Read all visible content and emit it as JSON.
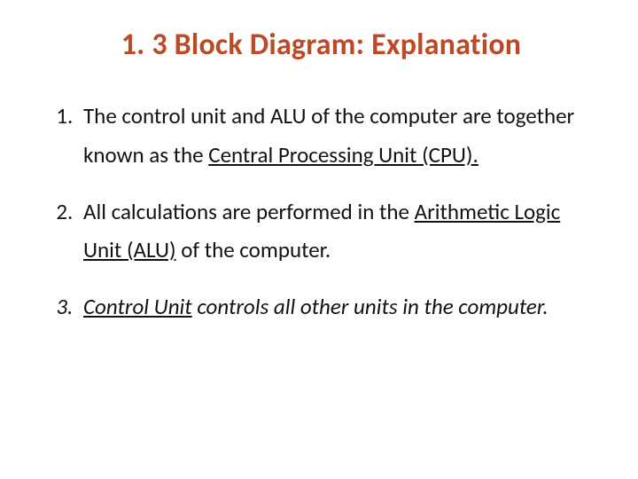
{
  "title": "1. 3 Block Diagram: Explanation",
  "items": [
    {
      "pre": "The control unit and ALU of the computer are together known as the ",
      "underlined": "Central Processing Unit (CPU).",
      "post": ""
    },
    {
      "pre": "All calculations are performed in the ",
      "underlined": "Arithmetic Logic Unit (ALU)",
      "post": " of the computer."
    },
    {
      "pre": "",
      "underlined": "Control Unit",
      "post": " controls all other units in the computer."
    }
  ]
}
